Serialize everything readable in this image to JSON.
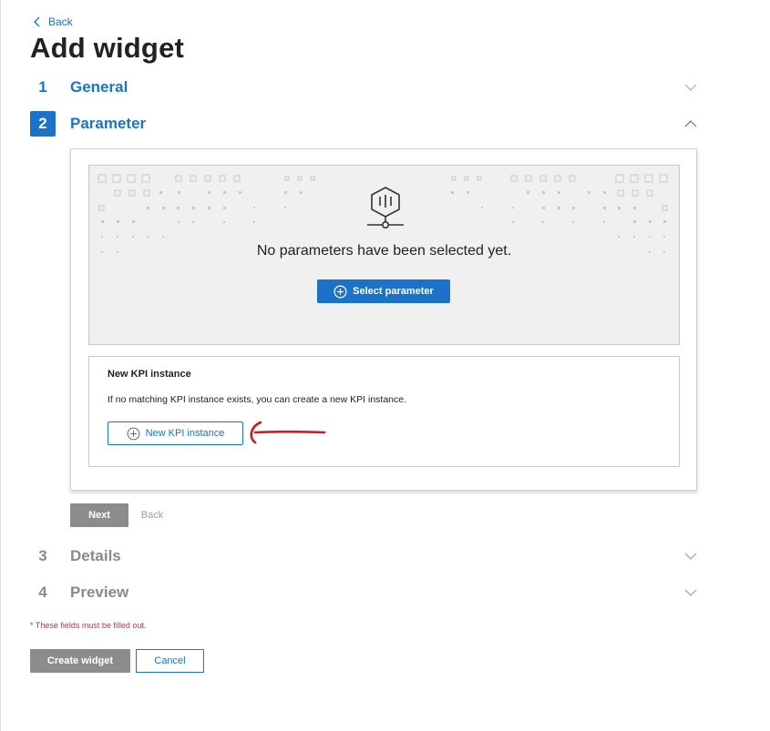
{
  "nav": {
    "back_label": "Back"
  },
  "page": {
    "title": "Add widget"
  },
  "steps": [
    {
      "number": "1",
      "label": "General"
    },
    {
      "number": "2",
      "label": "Parameter"
    },
    {
      "number": "3",
      "label": "Details"
    },
    {
      "number": "4",
      "label": "Preview"
    }
  ],
  "parameter": {
    "empty_message": "No parameters have been selected yet.",
    "select_button": "Select parameter",
    "empty_icon": "parameter-hub-icon"
  },
  "kpi": {
    "title": "New KPI instance",
    "description": "If no matching KPI instance exists, you can create a new KPI instance.",
    "button": "New KPI instance"
  },
  "step_actions": {
    "next": "Next",
    "back": "Back"
  },
  "form": {
    "required_note": "* These fields must be filled out.",
    "create_button": "Create widget",
    "cancel_button": "Cancel"
  },
  "colors": {
    "accent": "#1a73c9",
    "disabled": "#8c8c8c",
    "required": "#d2274a",
    "annotation": "#d11a1a"
  }
}
